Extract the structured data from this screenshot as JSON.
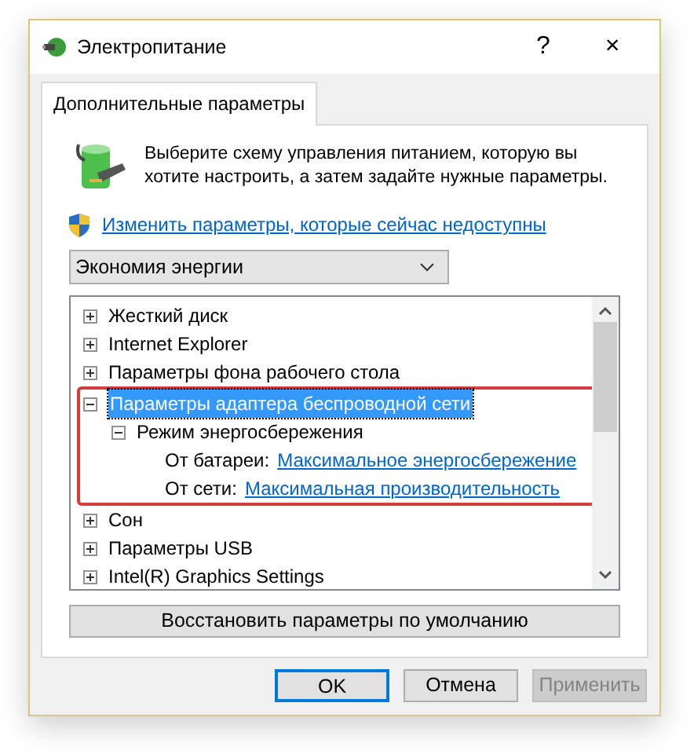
{
  "window": {
    "title": "Электропитание",
    "help": "?",
    "close": "×"
  },
  "tabs": [
    {
      "label": "Дополнительные параметры",
      "selected": true
    }
  ],
  "description": "Выберите схему управления питанием, которую вы хотите настроить, а затем задайте нужные параметры.",
  "admin_link": "Изменить параметры, которые сейчас недоступны",
  "plan_dropdown": {
    "value": "Экономия энергии"
  },
  "tree": {
    "items": [
      {
        "label": "Жесткий диск",
        "expanded": false,
        "selected": false,
        "highlighted": false
      },
      {
        "label": "Internet Explorer",
        "expanded": false,
        "selected": false,
        "highlighted": false
      },
      {
        "label": "Параметры фона рабочего стола",
        "expanded": false,
        "selected": false,
        "highlighted": false
      },
      {
        "label": "Параметры адаптера беспроводной сети",
        "expanded": true,
        "selected": true,
        "highlighted": true,
        "children": [
          {
            "kind": "group",
            "label": "Режим энергосбережения",
            "expanded": true,
            "selected": false,
            "children": [
              {
                "kind": "setting",
                "label": "От батареи:",
                "value": "Максимальное энергосбережение"
              },
              {
                "kind": "setting",
                "label": "От сети:",
                "value": "Максимальная производительность"
              }
            ]
          }
        ]
      },
      {
        "label": "Сон",
        "expanded": false,
        "selected": false,
        "highlighted": false
      },
      {
        "label": "Параметры USB",
        "expanded": false,
        "selected": false,
        "highlighted": false
      },
      {
        "label": "Intel(R) Graphics Settings",
        "expanded": false,
        "selected": false,
        "highlighted": false
      }
    ]
  },
  "restore_button": "Восстановить параметры по умолчанию",
  "buttons": [
    {
      "label": "OK",
      "kind": "default",
      "disabled": false
    },
    {
      "label": "Отмена",
      "kind": "normal",
      "disabled": false
    },
    {
      "label": "Применить",
      "kind": "normal",
      "disabled": true
    }
  ]
}
